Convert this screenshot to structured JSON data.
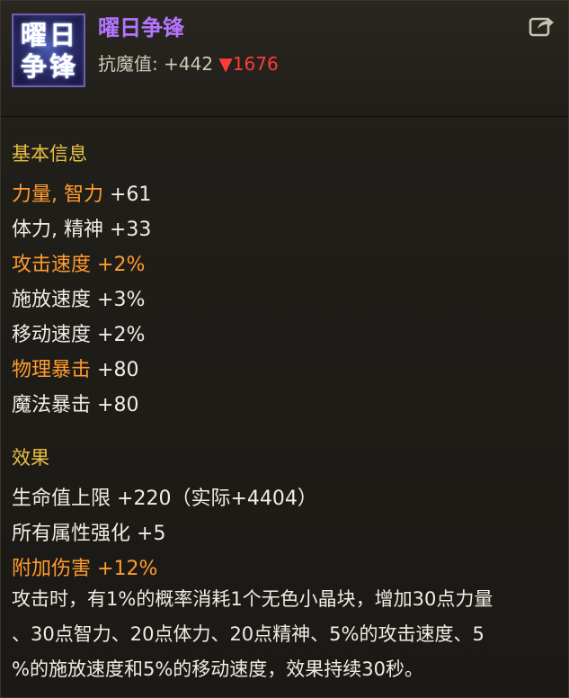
{
  "item": {
    "name": "曜日争锋",
    "icon_chars": [
      "曜",
      "日",
      "争",
      "锋"
    ],
    "stat_label": "抗魔值:",
    "stat_value": "+442",
    "stat_delta_arrow": "▼",
    "stat_delta_value": "1676",
    "share_icon": "share-icon"
  },
  "basic": {
    "title": "基本信息",
    "rows": [
      {
        "label": "力量, 智力",
        "value": "+61",
        "highlight": true,
        "value_highlight": false
      },
      {
        "label": "体力, 精神",
        "value": "+33",
        "highlight": false,
        "value_highlight": false
      },
      {
        "label": "攻击速度",
        "value": "+2%",
        "highlight": true,
        "value_highlight": true
      },
      {
        "label": "施放速度",
        "value": "+3%",
        "highlight": false,
        "value_highlight": false
      },
      {
        "label": "移动速度",
        "value": "+2%",
        "highlight": false,
        "value_highlight": false
      },
      {
        "label": "物理暴击",
        "value": "+80",
        "highlight": true,
        "value_highlight": false
      },
      {
        "label": "魔法暴击",
        "value": "+80",
        "highlight": false,
        "value_highlight": false
      }
    ]
  },
  "effect": {
    "title": "效果",
    "rows": [
      {
        "label": "生命值上限",
        "value": "+220（实际+4404）",
        "highlight": false,
        "value_highlight": false
      },
      {
        "label": "所有属性强化",
        "value": "+5",
        "highlight": false,
        "value_highlight": false
      },
      {
        "label": "附加伤害",
        "value": "+12%",
        "highlight": true,
        "value_highlight": true
      }
    ],
    "description_lines": [
      "攻击时，有1%的概率消耗1个无色小晶块，增加30点力量",
      "、30点智力、20点体力、20点精神、5%的攻击速度、5",
      "%的施放速度和5%的移动速度，效果持续30秒。"
    ]
  },
  "colors": {
    "name": "#b476ff",
    "section_title": "#e8c040",
    "highlight": "#ff9b2f",
    "normal": "#f0ece4",
    "decrease": "#ff3b3b"
  }
}
